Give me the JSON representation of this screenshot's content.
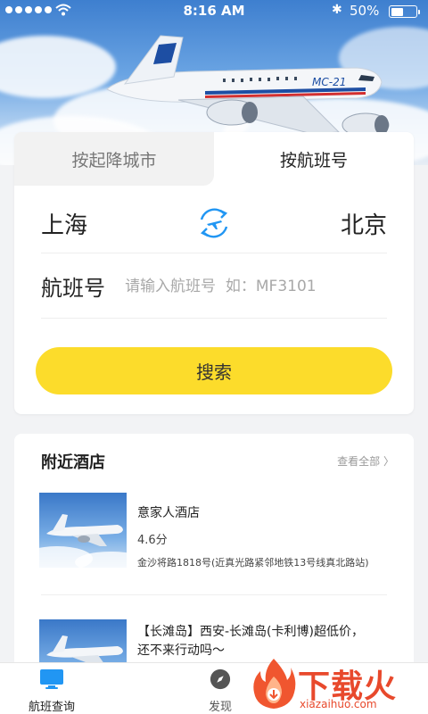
{
  "status_bar": {
    "time": "8:16 AM",
    "battery_text": "50%",
    "battery_level": 0.5,
    "icons": [
      "signal-dots-icon",
      "wifi-icon",
      "bluetooth-icon",
      "battery-icon"
    ]
  },
  "hero": {
    "plane_livery": "MC-21"
  },
  "search_card": {
    "tabs": [
      {
        "label": "按起降城市",
        "active": false
      },
      {
        "label": "按航班号",
        "active": true
      }
    ],
    "from_city": "上海",
    "to_city": "北京",
    "swap_icon": "swap-plane-icon",
    "flight_label": "航班号",
    "flight_placeholder": "请输入航班号  如：MF3101",
    "search_button": "搜索"
  },
  "hotels": {
    "title": "附近酒店",
    "more_label": "查看全部 〉",
    "items": [
      {
        "name": "意家人酒店",
        "score": "4.6分",
        "address": "金沙将路1818号(近真光路紧邻地铁13号线真北路站)"
      },
      {
        "promo": "【长滩岛】西安-长滩岛(卡利博)超低价，还不来行动吗～"
      }
    ]
  },
  "tab_bar": {
    "items": [
      {
        "label": "航班查询",
        "icon": "monitor-icon",
        "active": true
      },
      {
        "label": "发现",
        "icon": "compass-icon",
        "active": false
      }
    ]
  },
  "watermark": {
    "text": "下载火",
    "url": "xiazaihuo.com"
  },
  "colors": {
    "accent_yellow": "#fcdc2b",
    "active_blue": "#2196f3",
    "watermark_red": "#e8492c"
  }
}
